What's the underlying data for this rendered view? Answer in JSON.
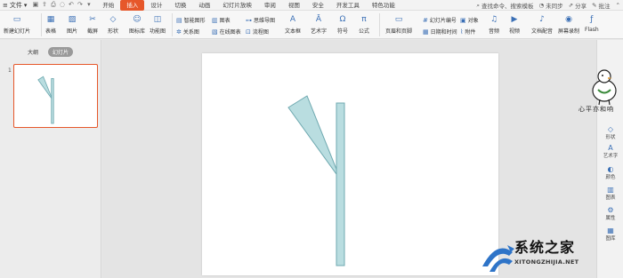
{
  "menubar": {
    "file_label": "文件",
    "tabs": [
      {
        "label": "开始",
        "active": false
      },
      {
        "label": "插入",
        "active": true
      },
      {
        "label": "设计",
        "active": false
      },
      {
        "label": "切换",
        "active": false
      },
      {
        "label": "动画",
        "active": false
      },
      {
        "label": "幻灯片放映",
        "active": false
      },
      {
        "label": "审阅",
        "active": false
      },
      {
        "label": "视图",
        "active": false
      },
      {
        "label": "安全",
        "active": false
      },
      {
        "label": "开发工具",
        "active": false
      },
      {
        "label": "特色功能",
        "active": false
      }
    ],
    "search_placeholder": "查找命令、搜索模板",
    "sync_label": "未同步",
    "share_label": "分享",
    "comment_label": "批注"
  },
  "ribbon": {
    "new_slide": "新建幻灯片",
    "table": "表格",
    "picture": "图片",
    "screenshot": "截屏",
    "shape": "形状",
    "icon_lib": "图标库",
    "function_chart": "功能图",
    "smart_graphic": "智能图形",
    "chart": "图表",
    "mind_map": "思维导图",
    "relation_chart": "关系图",
    "online_chart": "在线图表",
    "flowchart": "流程图",
    "textbox": "文本框",
    "wordart": "艺术字",
    "symbol": "符号",
    "formula": "公式",
    "header_footer": "页眉和页脚",
    "slide_number": "幻灯片编号",
    "object": "对象",
    "datetime": "日期和时间",
    "attachment": "附件",
    "audio": "音频",
    "video": "视频",
    "doc_voice": "文档配音",
    "screen_record": "屏幕录制",
    "flash": "Flash"
  },
  "left_panel": {
    "tab_outline": "大纲",
    "tab_slides": "幻灯片",
    "slide_number": "1"
  },
  "right_sidebar": {
    "items": [
      "形状",
      "艺术字",
      "颜色",
      "图表",
      "属性",
      "图库"
    ]
  },
  "watermarks": {
    "top_text": "心平亦和响",
    "site_name": "系统之家",
    "site_url": "XITONGZHIJIA.NET"
  },
  "colors": {
    "accent": "#e6572a",
    "shape_fill": "#b9dde0",
    "shape_stroke": "#6fa9b0"
  }
}
